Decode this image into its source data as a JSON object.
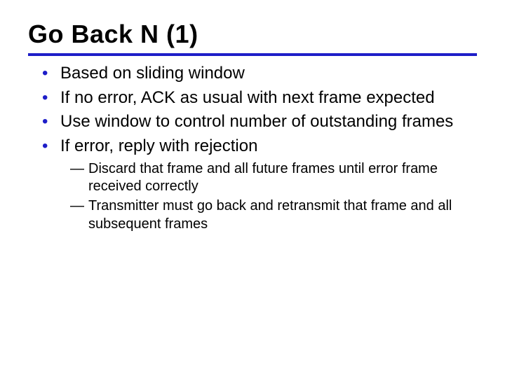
{
  "title": "Go Back N (1)",
  "bullets": [
    {
      "text": "Based on sliding window"
    },
    {
      "text": "If no error, ACK as usual with next frame expected"
    },
    {
      "text": "Use window to control number of outstanding frames"
    },
    {
      "text": "If error, reply with rejection",
      "sub": [
        "Discard that frame and all future frames until error frame received correctly",
        "Transmitter must go back and retransmit that frame and all subsequent frames"
      ]
    }
  ]
}
